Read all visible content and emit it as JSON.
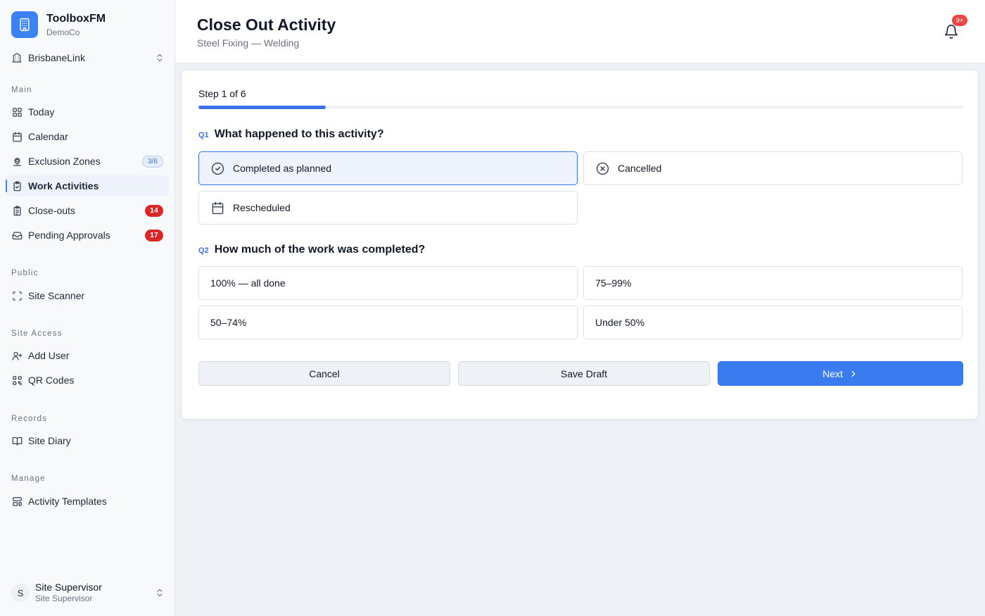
{
  "app": {
    "name": "ToolboxFM",
    "org": "DemoCo"
  },
  "site": {
    "name": "BrisbaneLink"
  },
  "sidebar": {
    "sections": [
      {
        "title": "Main",
        "items": [
          {
            "label": "Today",
            "icon": "grid-icon"
          },
          {
            "label": "Calendar",
            "icon": "calendar-icon"
          },
          {
            "label": "Exclusion Zones",
            "icon": "location-pin-icon",
            "badge": "3/6"
          },
          {
            "label": "Work Activities",
            "icon": "clipboard-check-icon",
            "active": true
          },
          {
            "label": "Close-outs",
            "icon": "clipboard-list-icon",
            "badge": "14"
          },
          {
            "label": "Pending Approvals",
            "icon": "inbox-icon",
            "badge": "17"
          }
        ]
      },
      {
        "title": "Public",
        "items": [
          {
            "label": "Site Scanner",
            "icon": "scan-icon"
          }
        ]
      },
      {
        "title": "Site Access",
        "items": [
          {
            "label": "Add User",
            "icon": "user-plus-icon"
          },
          {
            "label": "QR Codes",
            "icon": "qr-code-icon"
          }
        ]
      },
      {
        "title": "Records",
        "items": [
          {
            "label": "Site Diary",
            "icon": "book-open-icon"
          }
        ]
      },
      {
        "title": "Manage",
        "items": [
          {
            "label": "Activity Templates",
            "icon": "layout-template-icon"
          }
        ]
      }
    ]
  },
  "user": {
    "initial": "S",
    "name": "Site Supervisor",
    "role": "Site Supervisor"
  },
  "header": {
    "title": "Close Out Activity",
    "subtitle": "Steel Fixing — Welding",
    "notifications": "9+"
  },
  "form": {
    "step_label": "Step 1 of 6",
    "progress": 0.1667,
    "q1": {
      "num": "Q1",
      "text": "What happened to this activity?",
      "options": [
        {
          "label": "Completed as planned",
          "icon": "check-circle-icon",
          "selected": true
        },
        {
          "label": "Cancelled",
          "icon": "x-circle-icon"
        },
        {
          "label": "Rescheduled",
          "icon": "calendar-icon"
        }
      ]
    },
    "q2": {
      "num": "Q2",
      "text": "How much of the work was completed?",
      "options": [
        {
          "label": "100% — all done"
        },
        {
          "label": "75–99%"
        },
        {
          "label": "50–74%"
        },
        {
          "label": "Under 50%"
        }
      ]
    },
    "buttons": {
      "cancel": "Cancel",
      "save_draft": "Save Draft",
      "next": "Next"
    }
  },
  "colors": {
    "accent": "#3b7bf0",
    "badge_red": "#dc2626",
    "selected_bg": "#eef3fd"
  }
}
